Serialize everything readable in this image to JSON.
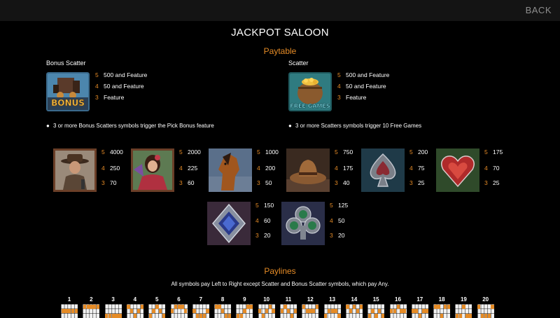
{
  "header": {
    "back_label": "BACK"
  },
  "title": "JACKPOT SALOON",
  "paytable": {
    "heading": "Paytable",
    "bonus_scatter": {
      "label": "Bonus Scatter",
      "image_text": "BONUS",
      "pays": [
        {
          "count": "5",
          "value": "500 and Feature"
        },
        {
          "count": "4",
          "value": "50 and Feature"
        },
        {
          "count": "3",
          "value": "Feature"
        }
      ],
      "note": "3 or more Bonus Scatters symbols trigger the Pick Bonus feature"
    },
    "scatter": {
      "label": "Scatter",
      "image_text": "FREE GAMES",
      "pays": [
        {
          "count": "5",
          "value": "500 and Feature"
        },
        {
          "count": "4",
          "value": "50 and Feature"
        },
        {
          "count": "3",
          "value": "Feature"
        }
      ],
      "note": "3 or more Scatters symbols trigger 10 Free Games"
    },
    "bullet": "●",
    "symbols": [
      {
        "icon": "cowboy-icon",
        "pays": [
          {
            "count": "5",
            "value": "4000"
          },
          {
            "count": "4",
            "value": "250"
          },
          {
            "count": "3",
            "value": "70"
          }
        ]
      },
      {
        "icon": "saloon-girl-icon",
        "pays": [
          {
            "count": "5",
            "value": "2000"
          },
          {
            "count": "4",
            "value": "225"
          },
          {
            "count": "3",
            "value": "60"
          }
        ]
      },
      {
        "icon": "horse-icon",
        "pays": [
          {
            "count": "5",
            "value": "1000"
          },
          {
            "count": "4",
            "value": "200"
          },
          {
            "count": "3",
            "value": "50"
          }
        ]
      },
      {
        "icon": "cowboy-hat-icon",
        "pays": [
          {
            "count": "5",
            "value": "750"
          },
          {
            "count": "4",
            "value": "175"
          },
          {
            "count": "3",
            "value": "40"
          }
        ]
      },
      {
        "icon": "spade-icon",
        "pays": [
          {
            "count": "5",
            "value": "200"
          },
          {
            "count": "4",
            "value": "75"
          },
          {
            "count": "3",
            "value": "25"
          }
        ]
      },
      {
        "icon": "heart-icon",
        "pays": [
          {
            "count": "5",
            "value": "175"
          },
          {
            "count": "4",
            "value": "70"
          },
          {
            "count": "3",
            "value": "25"
          }
        ]
      },
      {
        "icon": "diamond-icon",
        "pays": [
          {
            "count": "5",
            "value": "150"
          },
          {
            "count": "4",
            "value": "60"
          },
          {
            "count": "3",
            "value": "20"
          }
        ]
      },
      {
        "icon": "club-icon",
        "pays": [
          {
            "count": "5",
            "value": "125"
          },
          {
            "count": "4",
            "value": "50"
          },
          {
            "count": "3",
            "value": "20"
          }
        ]
      }
    ]
  },
  "paylines": {
    "heading": "Paylines",
    "description": "All symbols pay Left to Right except Scatter and Bonus Scatter symbols, which pay Any.",
    "lines": [
      {
        "label": "1",
        "rows": [
          1,
          1,
          1,
          1,
          1
        ]
      },
      {
        "label": "2",
        "rows": [
          0,
          0,
          0,
          0,
          0
        ]
      },
      {
        "label": "3",
        "rows": [
          2,
          2,
          2,
          2,
          2
        ]
      },
      {
        "label": "4",
        "rows": [
          0,
          1,
          2,
          1,
          0
        ]
      },
      {
        "label": "5",
        "rows": [
          2,
          1,
          0,
          1,
          2
        ]
      },
      {
        "label": "6",
        "rows": [
          1,
          0,
          0,
          0,
          1
        ]
      },
      {
        "label": "7",
        "rows": [
          1,
          2,
          2,
          2,
          1
        ]
      },
      {
        "label": "8",
        "rows": [
          0,
          0,
          1,
          2,
          2
        ]
      },
      {
        "label": "9",
        "rows": [
          2,
          2,
          1,
          0,
          0
        ]
      },
      {
        "label": "10",
        "rows": [
          1,
          2,
          1,
          0,
          1
        ]
      },
      {
        "label": "11",
        "rows": [
          1,
          0,
          1,
          2,
          1
        ]
      },
      {
        "label": "12",
        "rows": [
          0,
          1,
          1,
          1,
          0
        ]
      },
      {
        "label": "13",
        "rows": [
          2,
          1,
          1,
          1,
          2
        ]
      },
      {
        "label": "14",
        "rows": [
          0,
          1,
          0,
          1,
          0
        ]
      },
      {
        "label": "15",
        "rows": [
          2,
          1,
          2,
          1,
          2
        ]
      },
      {
        "label": "16",
        "rows": [
          1,
          1,
          0,
          1,
          1
        ]
      },
      {
        "label": "17",
        "rows": [
          1,
          1,
          2,
          1,
          1
        ]
      },
      {
        "label": "18",
        "rows": [
          0,
          0,
          2,
          0,
          0
        ]
      },
      {
        "label": "19",
        "rows": [
          2,
          2,
          0,
          2,
          2
        ]
      },
      {
        "label": "20",
        "rows": [
          0,
          2,
          2,
          2,
          0
        ]
      }
    ]
  },
  "colors": {
    "accent": "#e58b26",
    "background": "#000000",
    "topbar": "#141414"
  }
}
